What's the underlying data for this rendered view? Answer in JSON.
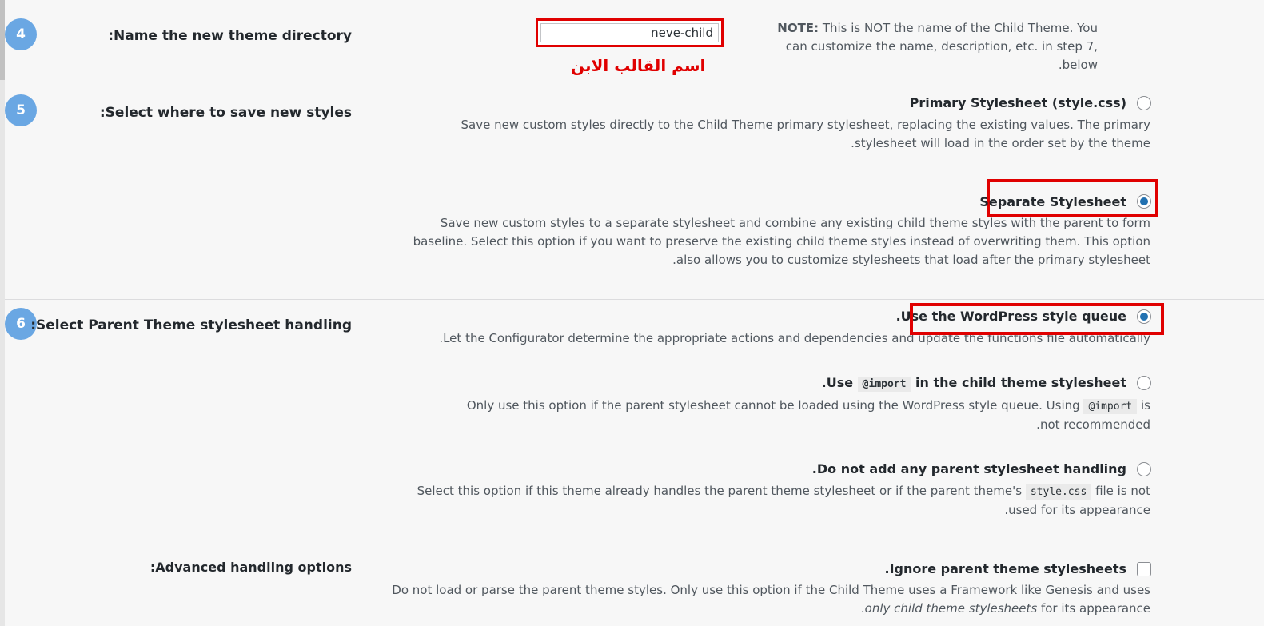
{
  "step4": {
    "number": "4",
    "label": "Name the new theme directory:",
    "input_value": "neve-child",
    "annotation": "اسم القالب الابن",
    "note_bold": "NOTE:",
    "note_text": " This is NOT the name of the Child Theme. You can customize the name, description, etc. in step 7, below."
  },
  "step5": {
    "number": "5",
    "label": "Select where to save new styles:",
    "options": [
      {
        "title": "Primary Stylesheet (style.css)",
        "checked": false,
        "desc": "Save new custom styles directly to the Child Theme primary stylesheet, replacing the existing values. The primary stylesheet will load in the order set by the theme."
      },
      {
        "title": "Separate Stylesheet",
        "checked": true,
        "desc": "Save new custom styles to a separate stylesheet and combine any existing child theme styles with the parent to form baseline. Select this option if you want to preserve the existing child theme styles instead of overwriting them. This option also allows you to customize stylesheets that load after the primary stylesheet."
      }
    ]
  },
  "step6": {
    "number": "6",
    "label": "Select Parent Theme stylesheet handling:",
    "options": [
      {
        "title": "Use the WordPress style queue.",
        "checked": true,
        "desc": "Let the Configurator determine the appropriate actions and dependencies and update the functions file automatically."
      },
      {
        "title_pre": "Use ",
        "title_code": "@import",
        "title_post": " in the child theme stylesheet.",
        "checked": false,
        "desc_pre": "Only use this option if the parent stylesheet cannot be loaded using the WordPress style queue. Using ",
        "desc_code": "@import",
        "desc_post": " is not recommended."
      },
      {
        "title": "Do not add any parent stylesheet handling.",
        "checked": false,
        "desc_pre": "Select this option if this theme already handles the parent theme stylesheet or if the parent theme's ",
        "desc_code": "style.css",
        "desc_post": " file is not used for its appearance."
      }
    ]
  },
  "advanced": {
    "label": "Advanced handling options:",
    "checkbox_title": "Ignore parent theme stylesheets.",
    "checked": false,
    "desc_pre": "Do not load or parse the parent theme styles. Only use this option if the Child Theme uses a Framework like Genesis and uses ",
    "desc_em": "only child theme stylesheets",
    "desc_post": " for its appearance."
  }
}
